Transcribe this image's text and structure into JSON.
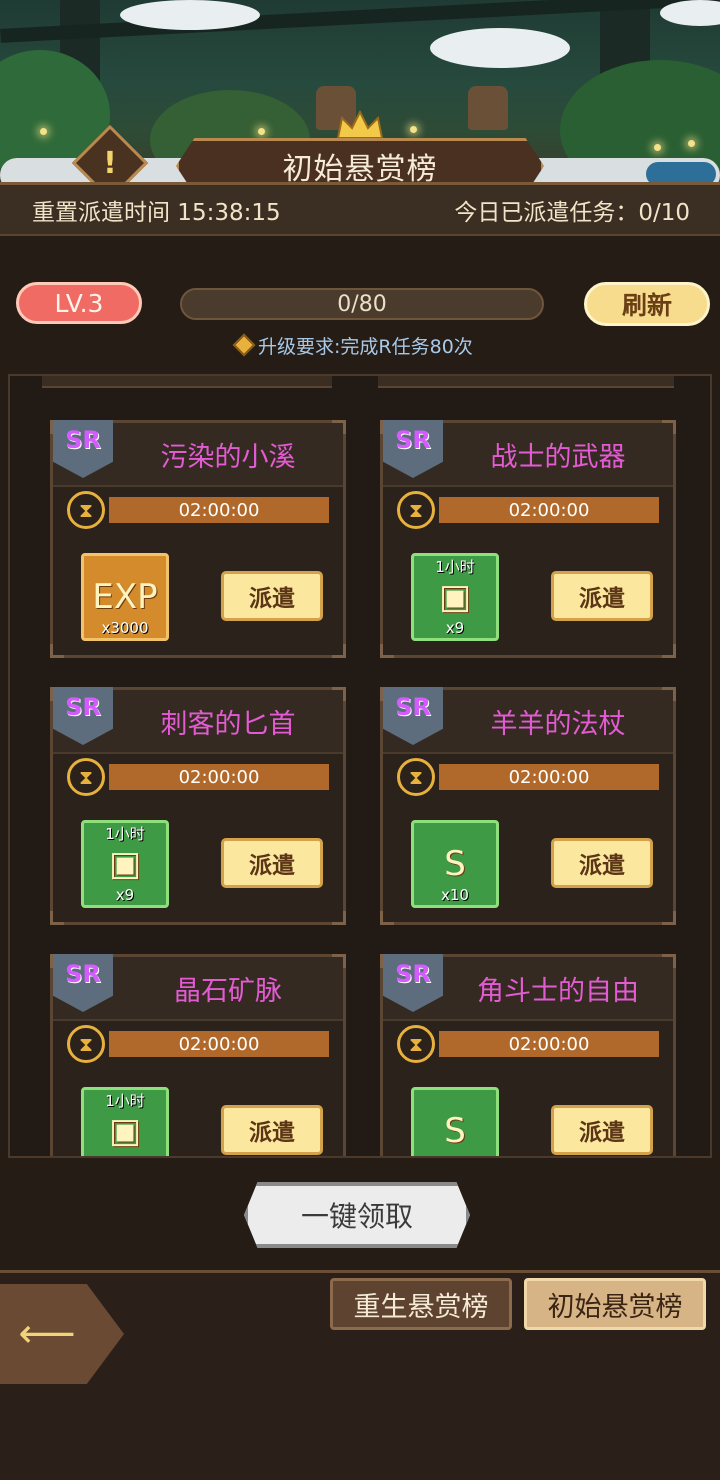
{
  "header": {
    "title": "初始悬赏榜",
    "alert_icon": "!"
  },
  "info": {
    "reset_label": "重置派遣时间 15:38:15",
    "dispatched_label": "今日已派遣任务：0/10"
  },
  "level": {
    "badge": "LV.3",
    "progress_text": "0/80",
    "progress_fraction": 0,
    "refresh_label": "刷新",
    "requirement": "升级要求:完成R任务80次"
  },
  "tasks": [
    {
      "rarity": "SR",
      "name": "污染的小溪",
      "time": "02:00:00",
      "reward_top": "",
      "reward_glyph": "EXP",
      "reward_qty": "x3000",
      "reward_style": "gold",
      "reward_icon": "exp-icon",
      "button": "派遣"
    },
    {
      "rarity": "SR",
      "name": "战士的武器",
      "time": "02:00:00",
      "reward_top": "1小时",
      "reward_glyph": "▣",
      "reward_qty": "x9",
      "reward_style": "green",
      "reward_icon": "exp-chest-icon",
      "button": "派遣"
    },
    {
      "rarity": "SR",
      "name": "刺客的匕首",
      "time": "02:00:00",
      "reward_top": "1小时",
      "reward_glyph": "▣",
      "reward_qty": "x9",
      "reward_style": "green",
      "reward_icon": "exp-chest-icon",
      "button": "派遣"
    },
    {
      "rarity": "SR",
      "name": "羊羊的法杖",
      "time": "02:00:00",
      "reward_top": "",
      "reward_glyph": "S",
      "reward_qty": "x10",
      "reward_style": "green",
      "reward_icon": "s-scroll-icon",
      "button": "派遣"
    },
    {
      "rarity": "SR",
      "name": "晶石矿脉",
      "time": "02:00:00",
      "reward_top": "1小时",
      "reward_glyph": "▣",
      "reward_qty": "",
      "reward_style": "green",
      "reward_icon": "gold-chest-icon",
      "button": "派遣"
    },
    {
      "rarity": "SR",
      "name": "角斗士的自由",
      "time": "02:00:00",
      "reward_top": "",
      "reward_glyph": "S",
      "reward_qty": "",
      "reward_style": "green",
      "reward_icon": "s-scroll-icon",
      "button": "派遣"
    }
  ],
  "claim_all": "一键领取",
  "tabs": [
    {
      "label": "重生悬赏榜",
      "active": false
    },
    {
      "label": "初始悬赏榜",
      "active": true
    }
  ],
  "colors": {
    "task_name": "#e25bd2",
    "level_badge": "#ef6b63",
    "refresh": "#f7dc8d",
    "timer_bar": "#b0692a"
  }
}
